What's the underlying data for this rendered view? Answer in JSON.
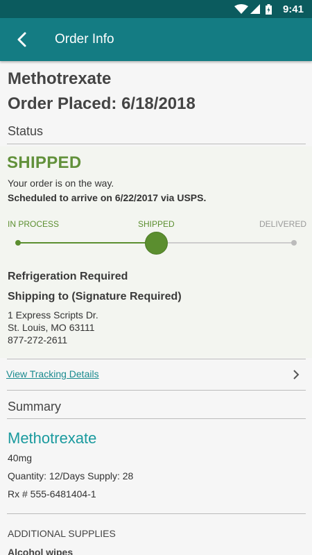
{
  "status_bar": {
    "time": "9:41"
  },
  "header": {
    "title": "Order Info"
  },
  "order": {
    "drug": "Methotrexate",
    "placed": "Order Placed: 6/18/2018"
  },
  "status_section": {
    "title": "Status",
    "headline": "SHIPPED",
    "message": "Your order is on the way.",
    "eta": "Scheduled to arrive on 6/22/2017 via USPS.",
    "stages": [
      "IN PROCESS",
      "SHIPPED",
      "DELIVERED"
    ],
    "current_stage_index": 1,
    "refrigeration": "Refrigeration Required",
    "shipping_label": "Shipping to (Signature Required)",
    "address": [
      "1 Express Scripts Dr.",
      "St. Louis, MO 63111",
      "877-272-2611"
    ]
  },
  "tracking_link": "View Tracking Details",
  "summary": {
    "title": "Summary",
    "drug": "Methotrexate",
    "dose": "40mg",
    "quantity": "Quantity: 12/Days Supply: 28",
    "rx": "Rx # 555-6481404-1"
  },
  "supplies": {
    "title": "ADDITIONAL SUPPLIES",
    "first_item": "Alcohol wipes"
  },
  "colors": {
    "primary": "#147c83",
    "status_bar": "#0b5b5e",
    "success": "#62913b",
    "link": "#1a8a8f"
  }
}
